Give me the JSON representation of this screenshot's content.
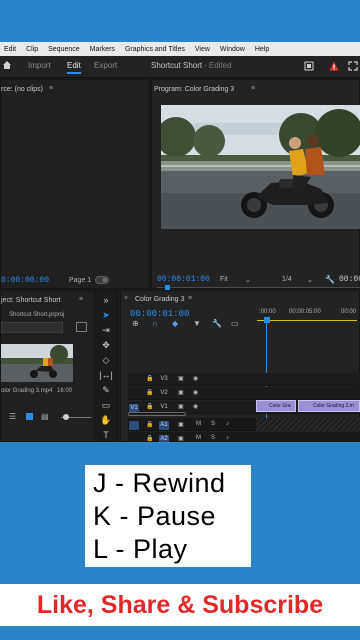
{
  "menu": {
    "items": [
      "Edit",
      "Clip",
      "Sequence",
      "Markers",
      "Graphics and Titles",
      "View",
      "Window",
      "Help"
    ]
  },
  "workspace": {
    "tab_import": "Import",
    "tab_edit": "Edit",
    "tab_export": "Export",
    "project_title": "Shortcut Short",
    "edited_label": "- Edited"
  },
  "source_panel": {
    "title": "rce: (no clips)",
    "timecode": "0:00:00:00",
    "page_label": "Page 1"
  },
  "program_panel": {
    "title": "Program: Color Grading 3",
    "timecode": "00:00:01:00",
    "fit_label": "Fit",
    "quality_label": "1/4",
    "end_timecode": "00:00"
  },
  "project_panel": {
    "title": "ject: Shortcut Short",
    "file": "Shortcut Short.prproj",
    "clip_name": "olor Grading 3.mp4",
    "clip_duration": "16:00"
  },
  "timeline_panel": {
    "title": "Color Grading 3",
    "timecode": "00:00:01:00",
    "ruler": [
      ":00:00",
      "00:00:05:00",
      "00:00"
    ],
    "video_tracks": [
      "V3",
      "V2",
      "V1"
    ],
    "audio_tracks": [
      "A1",
      "A2",
      "A3"
    ],
    "source_patch_v": "V1",
    "clips": [
      "Color Gra",
      "Color Grading 3.m"
    ]
  },
  "overlay": {
    "line1": "J - Rewind",
    "line2": "K - Pause",
    "line3": "L - Play"
  },
  "cta": {
    "text": "Like, Share & Subscribe"
  },
  "colors": {
    "accent": "#2d8ceb",
    "background": "#2b84c8",
    "cta_text": "#e02a2a",
    "clip": "#9b8fd6",
    "alert": "#e03030"
  }
}
